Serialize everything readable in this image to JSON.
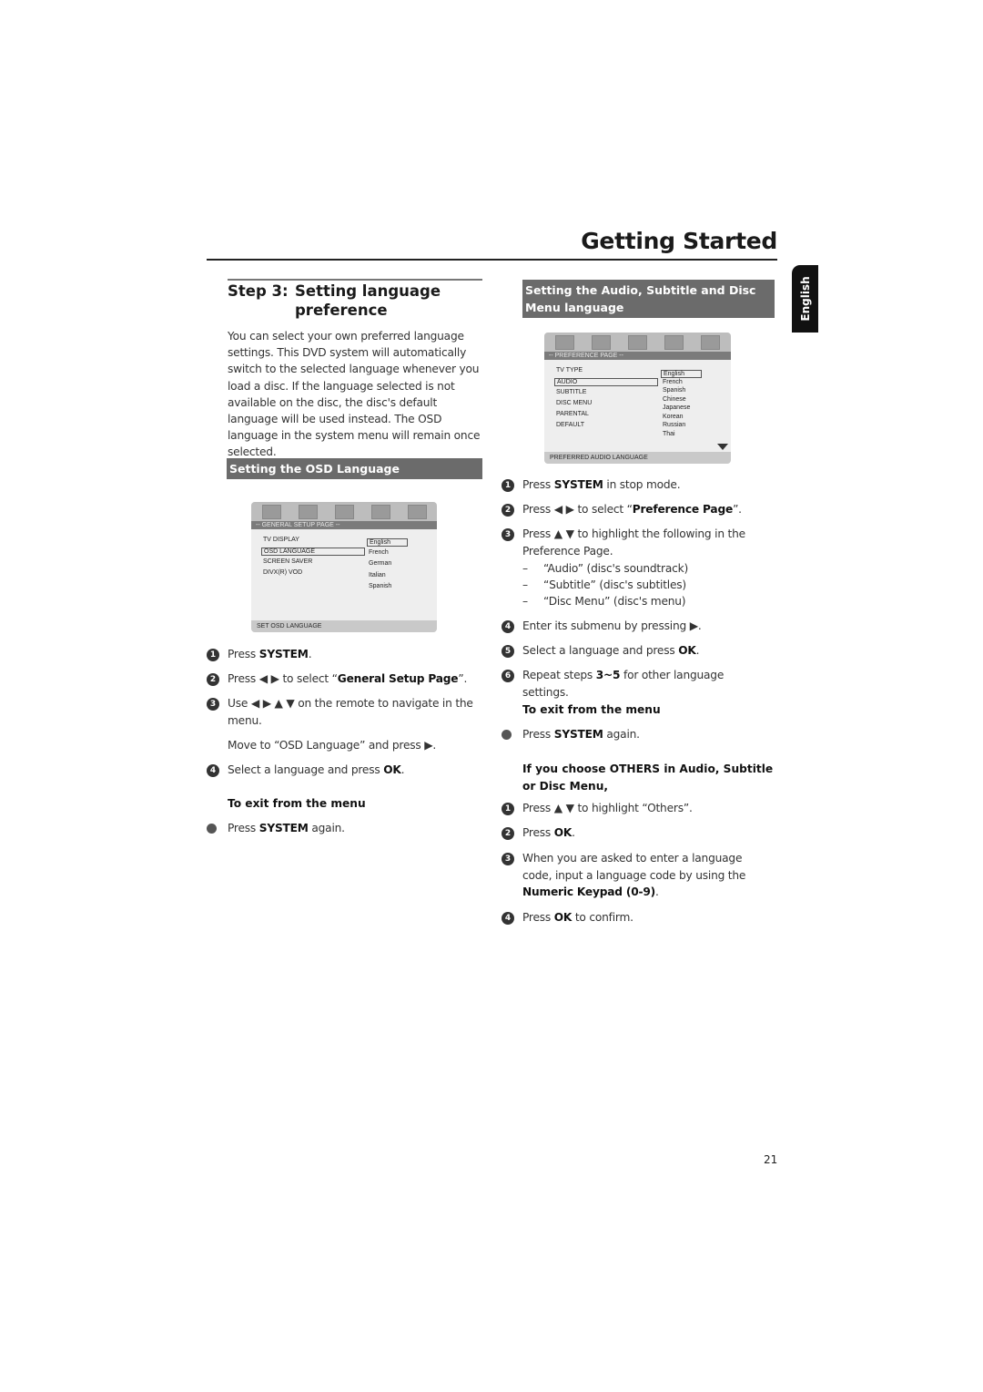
{
  "header": {
    "title": "Getting Started",
    "side_tab": "English"
  },
  "step": {
    "label": "Step 3:",
    "title": "Setting language preference",
    "intro": "You can select your own preferred language settings. This DVD system will automatically switch to the selected language whenever you load a disc. If the language selected is not available on the disc, the disc's default language will be used instead. The OSD language in the system menu will remain once selected."
  },
  "osd_section": {
    "heading": "Setting the OSD Language",
    "screen": {
      "page_title": "-- GENERAL SETUP PAGE --",
      "icons": [
        "setup-icon",
        "audio-icon",
        "video-icon",
        "preference-icon",
        "password-icon"
      ],
      "items": [
        "TV DISPLAY",
        "OSD LANGUAGE",
        "SCREEN SAVER",
        "DIVX(R) VOD"
      ],
      "selected_item": "OSD LANGUAGE",
      "options": [
        "English",
        "French",
        "German",
        "Italian",
        "Spanish"
      ],
      "selected_option": "English",
      "footer": "SET OSD LANGUAGE"
    },
    "steps": [
      {
        "n": "1",
        "pre": "Press ",
        "bold": "SYSTEM",
        "post": "."
      },
      {
        "n": "2",
        "pre": "Press ◀ ▶ to select “",
        "bold": "General Setup Page",
        "post": "”."
      },
      {
        "n": "3",
        "pre": "Use ◀ ▶ ▲ ▼ on the remote to navigate in the menu.",
        "bold": "",
        "post": ""
      },
      {
        "n": "",
        "pre": "Move to “OSD Language” and press ▶.",
        "bold": "",
        "post": ""
      },
      {
        "n": "4",
        "pre": "Select a language and press ",
        "bold": "OK",
        "post": "."
      }
    ],
    "exit_heading": "To exit from the menu",
    "exit_step": {
      "pre": "Press ",
      "bold": "SYSTEM",
      "post": " again."
    }
  },
  "audio_section": {
    "heading_line1": "Setting the Audio, Subtitle and Disc",
    "heading_line2": "Menu language",
    "screen": {
      "page_title": "-- PREFERENCE PAGE --",
      "icons": [
        "setup-icon",
        "audio-icon",
        "video-icon",
        "preference-icon",
        "password-icon"
      ],
      "items": [
        "TV TYPE",
        "AUDIO",
        "SUBTITLE",
        "DISC MENU",
        "PARENTAL",
        "DEFAULT"
      ],
      "selected_item": "AUDIO",
      "options": [
        "English",
        "French",
        "Spanish",
        "Chinese",
        "Japanese",
        "Korean",
        "Russian",
        "Thai"
      ],
      "selected_option": "English",
      "footer": "PREFERRED AUDIO LANGUAGE"
    },
    "steps": [
      {
        "n": "1",
        "pre": "Press ",
        "bold": "SYSTEM",
        "post": " in stop mode."
      },
      {
        "n": "2",
        "pre": "Press ◀ ▶ to select “",
        "bold": "Preference Page",
        "post": "”."
      },
      {
        "n": "3",
        "pre": "Press ▲ ▼ to highlight the following in the Preference Page.",
        "bold": "",
        "post": ""
      }
    ],
    "sub_items": [
      "“Audio” (disc's soundtrack)",
      "“Subtitle” (disc's subtitles)",
      "“Disc Menu” (disc's menu)"
    ],
    "steps2": [
      {
        "n": "4",
        "pre": "Enter its submenu by pressing ▶.",
        "bold": "",
        "post": ""
      },
      {
        "n": "5",
        "pre": "Select a language and press ",
        "bold": "OK",
        "post": "."
      },
      {
        "n": "6",
        "pre": "Repeat steps ",
        "bold": "3~5",
        "post": " for other language settings."
      }
    ],
    "exit_heading": "To exit from the menu",
    "exit_step": {
      "pre": "Press ",
      "bold": "SYSTEM",
      "post": " again."
    },
    "others_heading": "If you choose OTHERS in Audio, Subtitle or Disc Menu,",
    "others_steps": [
      {
        "n": "1",
        "pre": "Press ▲ ▼ to highlight “Others”.",
        "bold": "",
        "post": ""
      },
      {
        "n": "2",
        "pre": "Press ",
        "bold": "OK",
        "post": "."
      },
      {
        "n": "3",
        "pre": "When you are asked to enter a language code, input a language code by using the ",
        "bold": "Numeric Keypad (0-9)",
        "post": "."
      },
      {
        "n": "4",
        "pre": "Press ",
        "bold": "OK",
        "post": " to confirm."
      }
    ]
  },
  "footer": {
    "page_number": "21"
  }
}
